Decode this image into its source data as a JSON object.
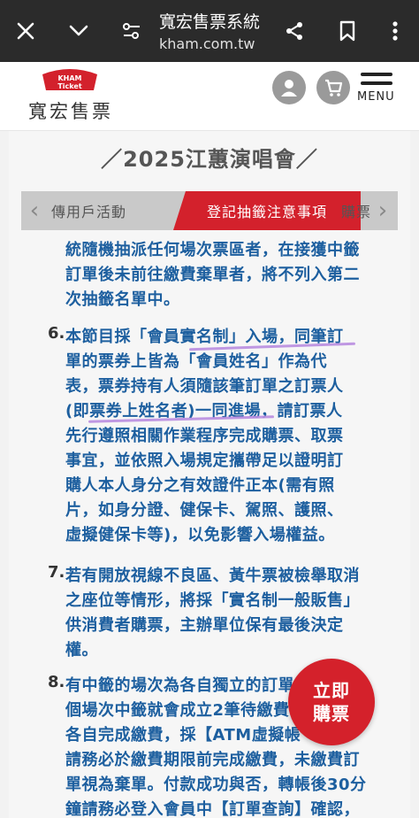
{
  "browser": {
    "title": "寬宏售票系統",
    "url": "kham.com.tw",
    "icons": [
      "close-icon",
      "chevron-down-icon",
      "tune-icon",
      "share-icon",
      "bookmark-icon",
      "more-vert-icon"
    ]
  },
  "header": {
    "logo_badge_line1": "KHAM",
    "logo_badge_line2": "Ticket",
    "logo_text": "寬宏售票",
    "menu_label": "MENU"
  },
  "event": {
    "title": "／2025江蕙演唱會／"
  },
  "tabs": {
    "items": [
      {
        "label": "傳用戶活動"
      },
      {
        "label": "登記抽籤注意事項",
        "active": true
      },
      {
        "label": "購票"
      }
    ]
  },
  "content": {
    "lines": [
      "統隨機抽派任何場次票區者，在接獲中籤",
      "訂單後未前往繳費棄單者，將不列入第二",
      "次抽籤名單中。"
    ],
    "item6": {
      "number": "6.",
      "lines": [
        "本節目採「會員實名制」入場，同筆訂",
        "單的票券上皆為「會員姓名」作為代",
        "表，票券持有人須隨該筆訂單之訂票人",
        "(即票券上姓名者)一同進場，請訂票人",
        "先行遵照相關作業程序完成購票、取票",
        "事宜，並依照入場規定攜帶足以證明訂",
        "購人本人身分之有效證件正本(需有照",
        "片，如身分證、健保卡、駕照、護照、",
        "虛擬健保卡等)，以免影響入場權益。"
      ]
    },
    "item7": {
      "number": "7.",
      "lines": [
        "若有開放視線不良區、黃牛票被檢舉取消",
        "之座位等情形，將採「實名制一般販售」",
        "供消費者購票，主辦單位保有最後決定",
        "權。"
      ]
    },
    "item8": {
      "number": "8.",
      "lines": [
        "有中籤的場次為各自獨立的訂單",
        "個場次中籤就會成立2筆待繳費",
        "各自完成繳費，採【ATM虛擬帳",
        "請務必於繳費期限前完成繳費，未繳費訂",
        "單視為棄單。付款成功與否，轉帳後30分",
        "鐘請務必登入會員中【訂單查詢】確認，"
      ]
    }
  },
  "buy_button": {
    "line1": "立即",
    "line2": "購票"
  },
  "colors": {
    "accent": "#d3212c",
    "text_blue": "#1d5f9f",
    "topbar": "#2b2b2b"
  }
}
